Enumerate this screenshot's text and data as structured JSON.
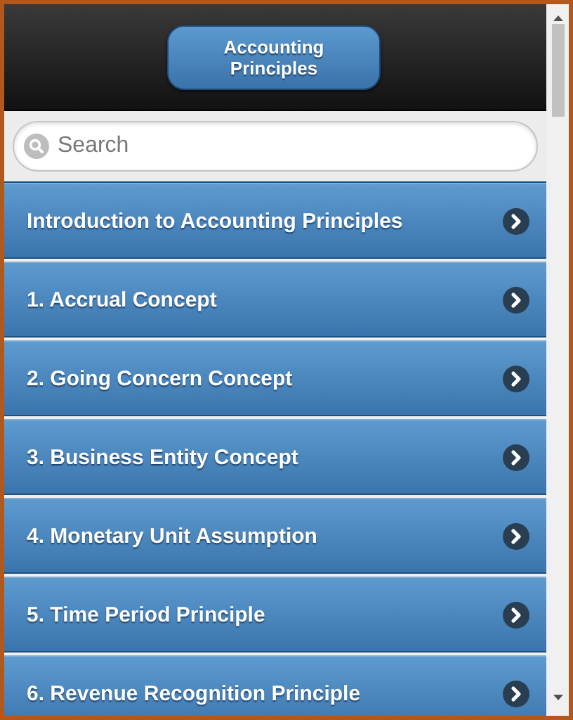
{
  "header": {
    "title_button": "Accounting Principles"
  },
  "search": {
    "placeholder": "Search"
  },
  "items": [
    {
      "label": "Introduction to Accounting Principles"
    },
    {
      "label": "1. Accrual Concept"
    },
    {
      "label": "2. Going Concern Concept"
    },
    {
      "label": "3. Business Entity Concept"
    },
    {
      "label": "4. Monetary Unit Assumption"
    },
    {
      "label": "5. Time Period Principle"
    },
    {
      "label": "6. Revenue Recognition Principle"
    }
  ]
}
